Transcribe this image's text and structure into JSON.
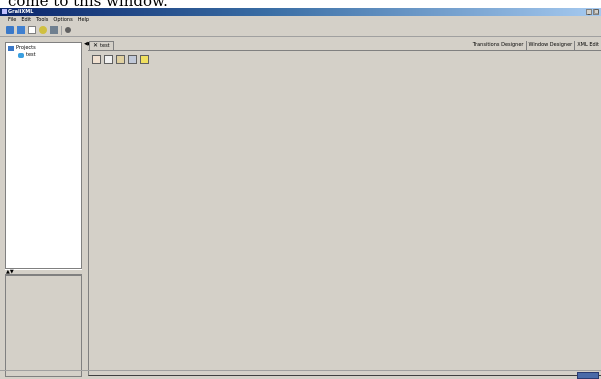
{
  "caption": "come to this window.",
  "window": {
    "title": "GraliXML"
  },
  "menu": [
    "File",
    "Edit",
    "Tools",
    "Options",
    "Help"
  ],
  "project_tree": {
    "root": "Projects",
    "items": [
      "test"
    ]
  },
  "document_tab": {
    "label": "test",
    "close": "✕"
  },
  "designer_tabs": [
    "Transitions Designer",
    "Window Designer",
    "XML Edit"
  ],
  "title_buttons": {
    "minimize": "_",
    "maximize": "□"
  },
  "colors": {
    "face": "#d4d0c8",
    "title_start": "#0a246a",
    "title_end": "#a6caf0"
  }
}
